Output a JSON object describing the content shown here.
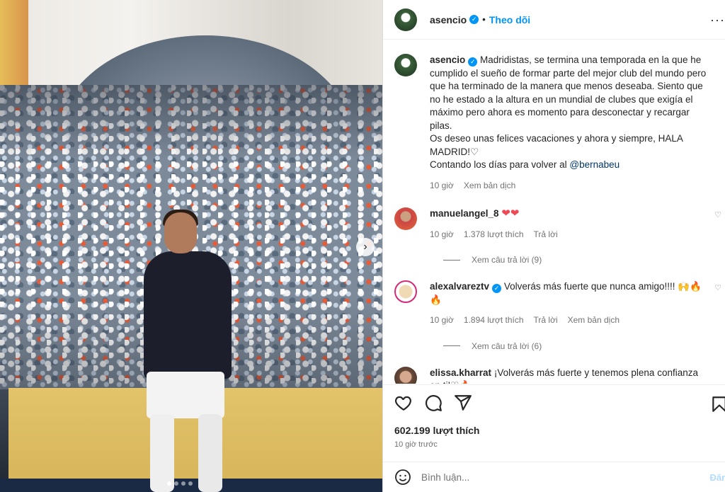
{
  "post": {
    "username": "asencio",
    "separator": "•",
    "follow_label": "Theo dõi",
    "more_icon": "more-horizontal-icon",
    "media": {
      "slide_count": 4,
      "active_slide": 1,
      "next_icon": "chevron-right-icon"
    }
  },
  "caption": {
    "username": "asencio",
    "paragraph_1": "Madridistas, se termina una temporada en la que he cumplido el sueño de formar parte del mejor club del mundo pero que ha terminado de la manera que menos deseaba. Siento que no he estado a la altura en un mundial de clubes que exigía el máximo pero ahora es momento para desconectar y recargar pilas.",
    "paragraph_2": "Os deseo unas felices vacaciones y ahora y siempre, HALA MADRID!♡",
    "paragraph_3_prefix": "Contando los días para volver al ",
    "mention": "@bernabeu",
    "time": "10 giờ",
    "translate": "Xem bản dịch"
  },
  "comments": [
    {
      "username": "manuelangel_8",
      "text": "❤❤",
      "time": "10 giờ",
      "likes": "1.378 lượt thích",
      "reply": "Trả lời",
      "replies_label": "Xem câu trả lời (9)"
    },
    {
      "username": "alexalvareztv",
      "text": "Volverás más fuerte que nunca amigo!!!! 🙌🔥",
      "text_line2": "🔥",
      "time": "10 giờ",
      "likes": "1.894 lượt thích",
      "reply": "Trả lời",
      "translate": "Xem bản dịch",
      "replies_label": "Xem câu trả lời (6)"
    },
    {
      "username": "elissa.kharrat",
      "text": "¡Volverás más fuerte y tenemos plena confianza en ti!♡🔥"
    }
  ],
  "actions": {
    "like_icon": "heart-icon",
    "comment_icon": "comment-icon",
    "share_icon": "share-icon",
    "save_icon": "bookmark-icon",
    "likes_count": "602.199 lượt thích",
    "posted_time": "10 giờ trước"
  },
  "comment_box": {
    "emoji_icon": "emoji-icon",
    "placeholder": "Bình luận...",
    "post_label": "Đăng"
  }
}
